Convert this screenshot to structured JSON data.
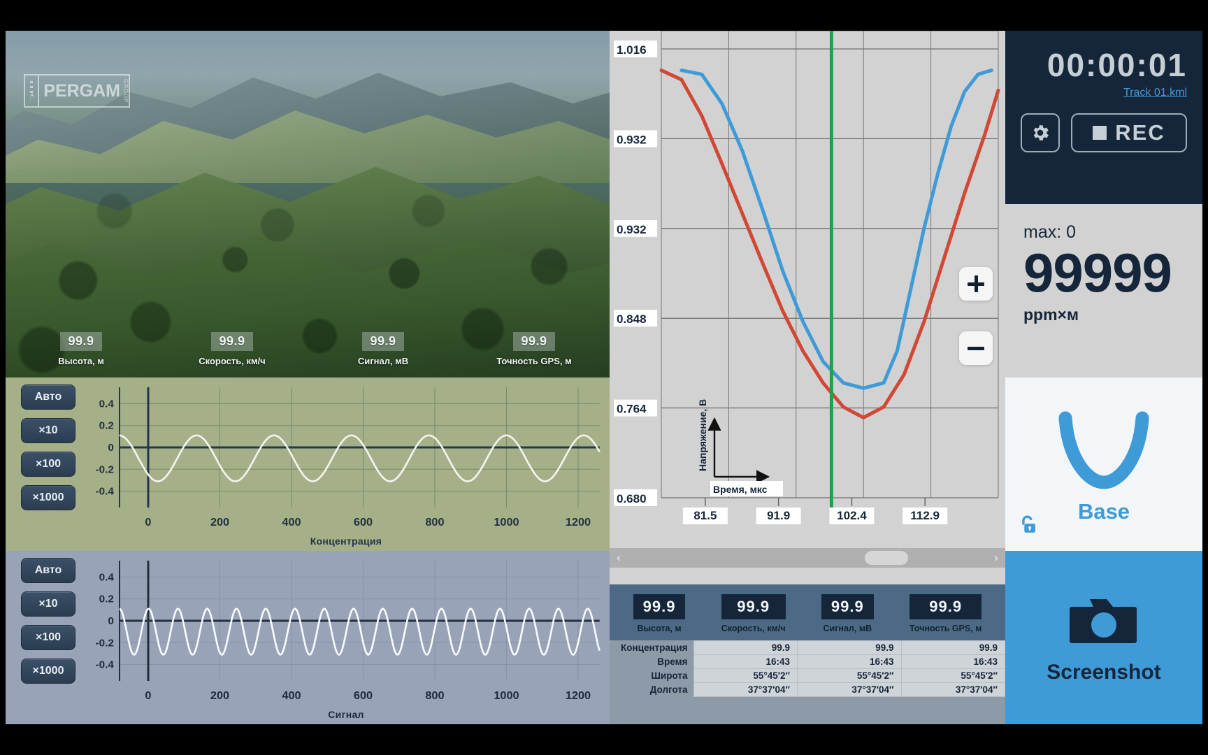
{
  "video": {
    "logo_word": "PERGAM",
    "logo_group": "GROUP",
    "stats": [
      {
        "value": "99.9",
        "caption": "Высота, м"
      },
      {
        "value": "99.9",
        "caption": "Скорость, км/ч"
      },
      {
        "value": "99.9",
        "caption": "Сигнал, мВ"
      },
      {
        "value": "99.9",
        "caption": "Точность GPS, м"
      }
    ]
  },
  "mini_buttons": [
    "Авто",
    "×10",
    "×100",
    "×1000"
  ],
  "chart_data": [
    {
      "type": "line",
      "title": "Концентрация",
      "xlabel": "",
      "ylabel": "",
      "x_ticks": [
        0,
        200,
        400,
        600,
        800,
        1000,
        1200
      ],
      "y_ticks": [
        0.4,
        0.2,
        0,
        -0.2,
        -0.4
      ],
      "xlim": [
        -80,
        1260
      ],
      "ylim": [
        -0.55,
        0.55
      ],
      "grid": true,
      "series": [
        {
          "name": "Концентрация",
          "color": "#f2f5ee",
          "waveform": "sine",
          "amplitude": 0.21,
          "offset": -0.1,
          "cycles": 6.2,
          "phase": 1.6
        }
      ]
    },
    {
      "type": "line",
      "title": "Сигнал",
      "xlabel": "",
      "ylabel": "",
      "x_ticks": [
        0,
        200,
        400,
        600,
        800,
        1000,
        1200
      ],
      "y_ticks": [
        0.4,
        0.2,
        0,
        -0.2,
        -0.4
      ],
      "xlim": [
        -80,
        1260
      ],
      "ylim": [
        -0.55,
        0.55
      ],
      "grid": true,
      "series": [
        {
          "name": "Сигнал",
          "color": "#f7f9fb",
          "waveform": "sine",
          "amplitude": 0.21,
          "offset": -0.1,
          "cycles": 16.4,
          "phase": 1.6
        }
      ]
    },
    {
      "type": "line",
      "title": "",
      "xlabel": "Время, мкс",
      "ylabel": "Напряжение, В",
      "x_ticks": [
        "81.5",
        "91.9",
        "102.4",
        "112.9"
      ],
      "y_ticks": [
        "1.016",
        "0.932",
        "0.932",
        "0.848",
        "0.764",
        "0.680"
      ],
      "grid": true,
      "cursor_color": "#22a14b",
      "series": [
        {
          "name": "signal-blue",
          "color": "#3f9ad8",
          "points": [
            [
              0.06,
              1.0
            ],
            [
              0.12,
              0.997
            ],
            [
              0.18,
              0.975
            ],
            [
              0.24,
              0.94
            ],
            [
              0.3,
              0.896
            ],
            [
              0.36,
              0.85
            ],
            [
              0.42,
              0.812
            ],
            [
              0.48,
              0.782
            ],
            [
              0.54,
              0.766
            ],
            [
              0.6,
              0.762
            ],
            [
              0.66,
              0.766
            ],
            [
              0.7,
              0.79
            ],
            [
              0.74,
              0.836
            ],
            [
              0.78,
              0.882
            ],
            [
              0.82,
              0.922
            ],
            [
              0.86,
              0.958
            ],
            [
              0.9,
              0.984
            ],
            [
              0.94,
              0.997
            ],
            [
              0.98,
              1.0
            ]
          ]
        },
        {
          "name": "signal-red",
          "color": "#d14836",
          "points": [
            [
              0.0,
              1.0
            ],
            [
              0.06,
              0.993
            ],
            [
              0.12,
              0.966
            ],
            [
              0.18,
              0.93
            ],
            [
              0.24,
              0.893
            ],
            [
              0.3,
              0.856
            ],
            [
              0.36,
              0.82
            ],
            [
              0.42,
              0.79
            ],
            [
              0.48,
              0.766
            ],
            [
              0.54,
              0.748
            ],
            [
              0.6,
              0.74
            ],
            [
              0.66,
              0.748
            ],
            [
              0.72,
              0.772
            ],
            [
              0.78,
              0.812
            ],
            [
              0.84,
              0.86
            ],
            [
              0.9,
              0.908
            ],
            [
              0.96,
              0.952
            ],
            [
              1.0,
              0.985
            ]
          ]
        }
      ]
    }
  ],
  "scope": {
    "zoom_in_label": "+",
    "zoom_out_label": "−",
    "scroll_left": "‹",
    "scroll_right": "›"
  },
  "data_panel": {
    "chips": [
      {
        "value": "99.9",
        "caption": "Высота, м"
      },
      {
        "value": "99.9",
        "caption": "Скорость, км/ч"
      },
      {
        "value": "99.9",
        "caption": "Сигнал, мВ"
      },
      {
        "value": "99.9",
        "caption": "Точность GPS, м"
      }
    ],
    "rows": [
      {
        "label": "Концентрация",
        "values": [
          "99.9",
          "99.9",
          "99.9"
        ]
      },
      {
        "label": "Время",
        "values": [
          "16:43",
          "16:43",
          "16:43"
        ]
      },
      {
        "label": "Широта",
        "values": [
          "55°45′2″",
          "55°45′2″",
          "55°45′2″"
        ]
      },
      {
        "label": "Долгота",
        "values": [
          "37°37′04″",
          "37°37′04″",
          "37°37′04″"
        ]
      }
    ]
  },
  "sidebar": {
    "timer": "00:00:01",
    "track_file": "Track 01.kml",
    "rec_label": "REC",
    "ppm_max": "max: 0",
    "ppm_value": "99999",
    "ppm_unit": "ppm×м",
    "base_label": "Base",
    "screenshot_label": "Screenshot"
  },
  "colors": {
    "accent_blue": "#3f9ad8",
    "dark_navy": "#16263a",
    "curve_red": "#d14836",
    "cursor_green": "#22a14b"
  }
}
